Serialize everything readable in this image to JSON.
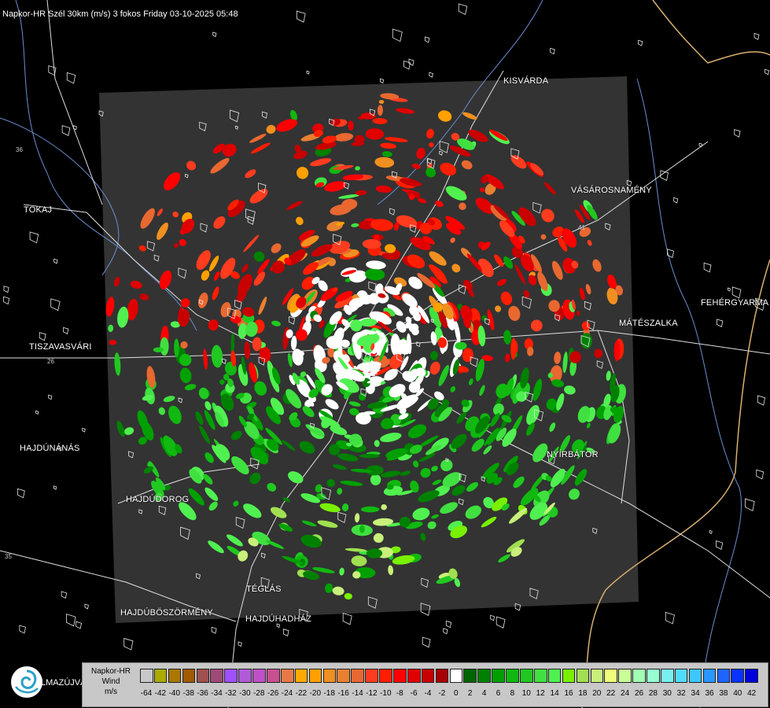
{
  "header": "Napkor-HR Szél 30km (m/s) 3 fokos Friday 03-10-2025 05:48",
  "places": [
    {
      "id": "kisvarda",
      "label": "KISVÁRDA"
    },
    {
      "id": "tokaj",
      "label": "TOKAJ"
    },
    {
      "id": "vasarosnameny",
      "label": "VÁSÁROSNAMÉNY"
    },
    {
      "id": "fehergyarmat",
      "label": "FEHÉRGYARMA"
    },
    {
      "id": "mateszalka",
      "label": "MÁTÉSZALKA"
    },
    {
      "id": "tiszavasvari",
      "label": "TISZAVASVÁRI"
    },
    {
      "id": "hajdunanas",
      "label": "HAJDÚNÁNÁS"
    },
    {
      "id": "nyirbator",
      "label": "NYÍRBÁTOR"
    },
    {
      "id": "hajdudorog",
      "label": "HAJDÚDOROG"
    },
    {
      "id": "teglas",
      "label": "TÉGLÁS"
    },
    {
      "id": "hajduboszormeny",
      "label": "HAJDÚBÖSZÖRMÉNY"
    },
    {
      "id": "hajduhadhaz",
      "label": "HAJDÚHADHÁZ"
    }
  ],
  "road_numbers": [
    "36",
    "41",
    "35",
    "26"
  ],
  "legend": {
    "line1": "Napkor-HR",
    "line2": "Wind",
    "line3": "m/s",
    "colors": [
      "#c8c8c8",
      "#aaaa00",
      "#aa7700",
      "#a05a00",
      "#a05050",
      "#a04a78",
      "#a050ff",
      "#b05ad8",
      "#c050c8",
      "#c85090",
      "#e87848",
      "#ffaa00",
      "#ffa000",
      "#f09020",
      "#e88030",
      "#e86830",
      "#ff3c1e",
      "#ff1e00",
      "#ff0000",
      "#e00000",
      "#c80000",
      "#a80000",
      "#ffffff",
      "#006400",
      "#008000",
      "#00a000",
      "#10b810",
      "#20c820",
      "#40e040",
      "#50f050",
      "#78f000",
      "#a0e050",
      "#c8f07a",
      "#f0ff78",
      "#c8ff96",
      "#a0ffb4",
      "#96ffd2",
      "#78f0f0",
      "#50dcff",
      "#3cc8ff",
      "#2896ff",
      "#1e64ff",
      "#0a32ff",
      "#0000dc"
    ],
    "ticks": [
      "-64",
      "-42",
      "-40",
      "-38",
      "-36",
      "-34",
      "-32",
      "-30",
      "-28",
      "-26",
      "-24",
      "-22",
      "-20",
      "-18",
      "-16",
      "-14",
      "-12",
      "-10",
      "-8",
      "-6",
      "-4",
      "-2",
      "0",
      "2",
      "4",
      "6",
      "8",
      "10",
      "12",
      "14",
      "16",
      "18",
      "20",
      "22",
      "24",
      "26",
      "28",
      "30",
      "32",
      "34",
      "36",
      "38",
      "40",
      "42"
    ]
  },
  "logo_text": "LMAZÚJVÁR"
}
